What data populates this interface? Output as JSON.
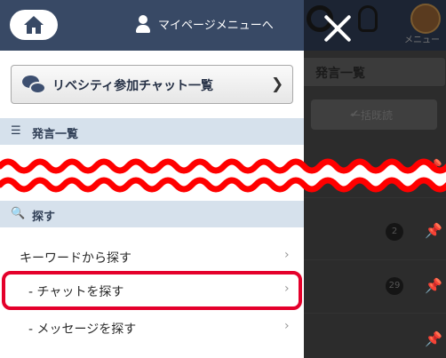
{
  "background_page": {
    "menu_label": "メニュー",
    "list_tab_label": "発言一覧",
    "mark_all_read_label": "一括既読",
    "badges": [
      "2",
      "29"
    ]
  },
  "panel": {
    "home_icon": "home-icon",
    "mypage_link_label": "マイページメニューへ",
    "chat_list_button_label": "リベシティ参加チャット一覧",
    "sections": {
      "posts": {
        "icon": "list-icon",
        "label": "発言一覧"
      },
      "search": {
        "icon": "search-icon",
        "label": "探す"
      }
    },
    "search_items": [
      {
        "label": "キーワードから探す"
      },
      {
        "label": "- チャットを探す"
      },
      {
        "label": "- メッセージを探す"
      }
    ]
  },
  "annotation": {
    "highlight_color": "#e4002b",
    "wave_color": "#ff0000"
  },
  "colors": {
    "header_navy": "#384965",
    "section_bg": "#d6e1ec"
  }
}
